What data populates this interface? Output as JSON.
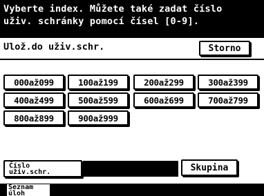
{
  "header": {
    "instruction_line1": "Vyberte index. Můžete také zadat číslo",
    "instruction_line2": "uživ. schránky pomocí čísel [0-9]."
  },
  "subheader": {
    "title": "Ulož.do uživ.schr.",
    "cancel_label": "Storno"
  },
  "index_buttons": [
    "000až099",
    "100až199",
    "200až299",
    "300až399",
    "400až499",
    "500až599",
    "600až699",
    "700až799",
    "800až899",
    "900až999"
  ],
  "bottom": {
    "box_number_label_line1": "Číslo",
    "box_number_label_line2": "uživ.schr.",
    "box_number_value": "",
    "group_label": "Skupina"
  },
  "footer": {
    "tab_label_line1": "Seznam",
    "tab_label_line2": "úloh"
  }
}
